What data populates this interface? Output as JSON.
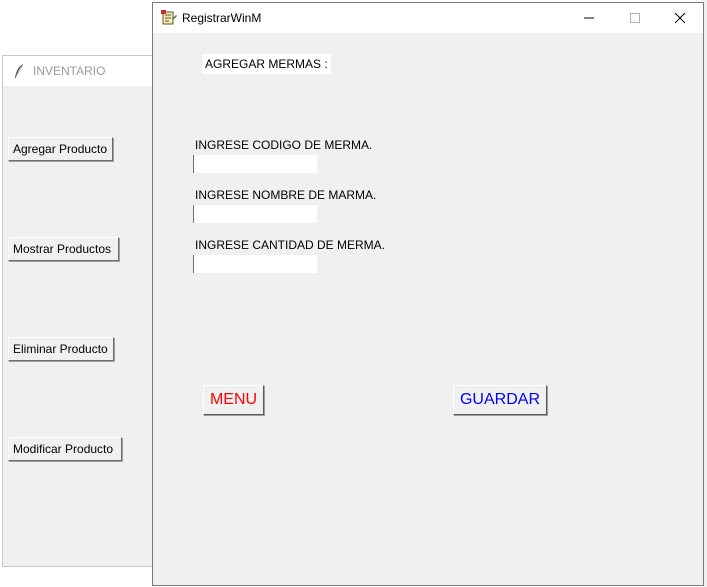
{
  "inventario_window": {
    "title": "INVENTARIO",
    "buttons": [
      {
        "label": "Agregar Producto"
      },
      {
        "label": "Mostrar Productos"
      },
      {
        "label": "Eliminar Producto"
      },
      {
        "label": "Modificar Producto"
      }
    ]
  },
  "registrar_window": {
    "title": "RegistrarWinM",
    "heading": "AGREGAR MERMAS :",
    "fields": [
      {
        "label": "INGRESE CODIGO DE MERMA.",
        "value": ""
      },
      {
        "label": "INGRESE NOMBRE DE MARMA.",
        "value": ""
      },
      {
        "label": "INGRESE CANTIDAD DE MERMA.",
        "value": ""
      }
    ],
    "menu_button": {
      "label": "MENU",
      "color": "#ff0000"
    },
    "save_button": {
      "label": "GUARDAR",
      "color": "#0000ff"
    }
  }
}
